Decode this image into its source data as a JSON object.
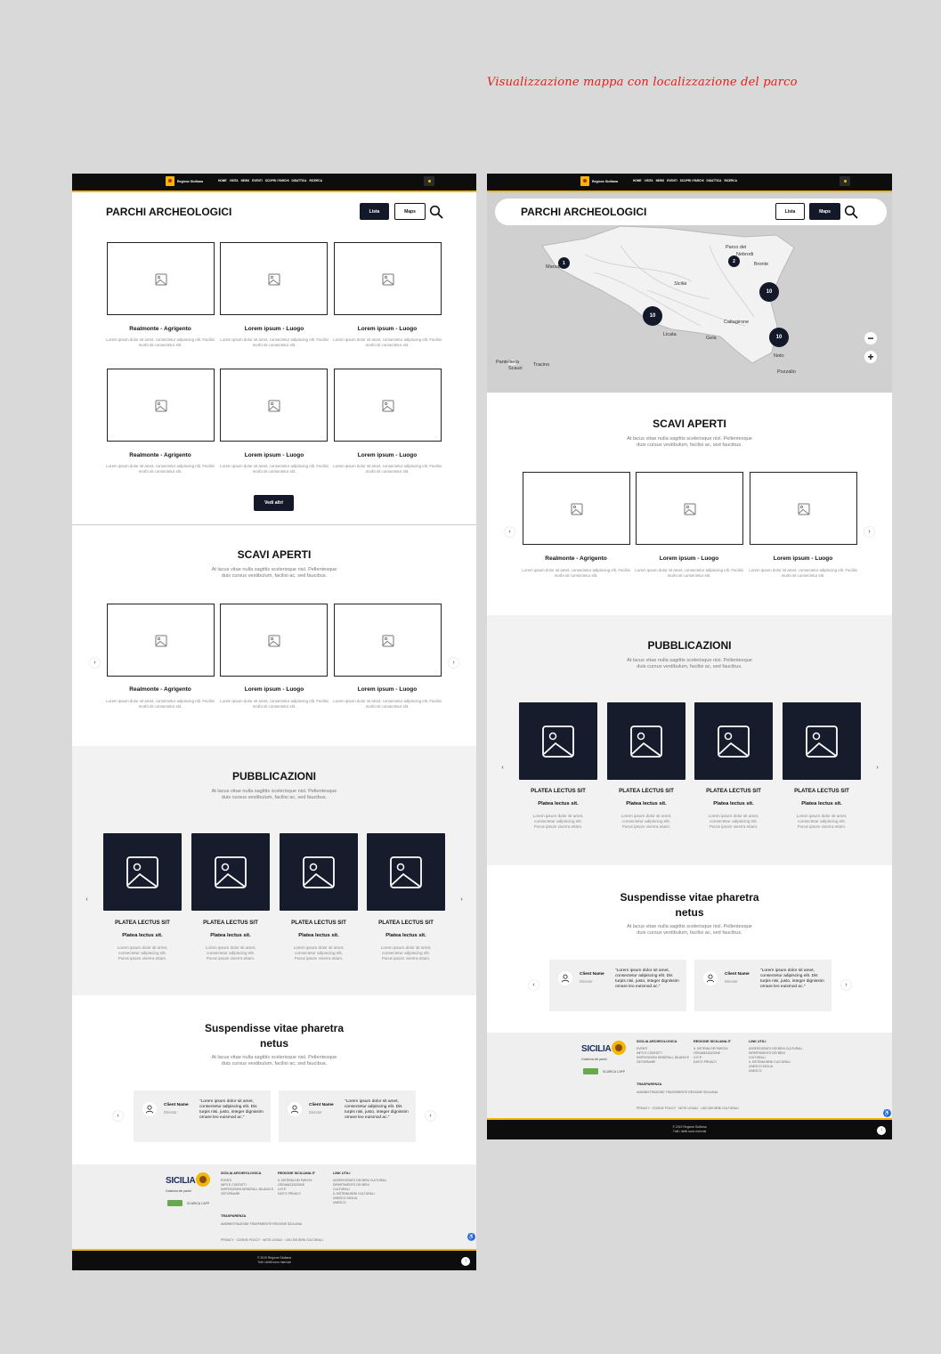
{
  "annotation": "Visualizzazione mappa con localizzazione del parco",
  "nav": {
    "brand": "Regione Siciliana",
    "items": [
      "HOME",
      "VISITA",
      "NEWS",
      "EVENTI",
      "SCOPRI I PARCHI",
      "DIDATTICA",
      "RICERCA"
    ]
  },
  "header": {
    "title": "PARCHI ARCHEOLOGICI",
    "lista": "Lista",
    "maps": "Maps"
  },
  "parks": [
    {
      "title": "Realmonte - Agrigento",
      "desc": "Lorem ipsum dolor sit amet, consectetur adipiscing elit. Facilisi morbi sit consectetur elit."
    },
    {
      "title": "Lorem ipsum - Luogo",
      "desc": "Lorem ipsum dolor sit amet, consectetur adipiscing elit. Facilisi morbi sit consectetur elit."
    },
    {
      "title": "Lorem ipsum - Luogo",
      "desc": "Lorem ipsum dolor sit amet, consectetur adipiscing elit. Facilisi morbi sit consectetur elit."
    },
    {
      "title": "Realmonte - Agrigento",
      "desc": "Lorem ipsum dolor sit amet, consectetur adipiscing elit. Facilisi morbi sit consectetur elit."
    },
    {
      "title": "Lorem ipsum - Luogo",
      "desc": "Lorem ipsum dolor sit amet, consectetur adipiscing elit. Facilisi morbi sit consectetur elit."
    },
    {
      "title": "Lorem ipsum - Luogo",
      "desc": "Lorem ipsum dolor sit amet, consectetur adipiscing elit. Facilisi morbi sit consectetur elit."
    }
  ],
  "vedi_altri": "Vedi altri",
  "scavi": {
    "title": "SCAVI APERTI",
    "subtitle_l1": "At lacus vitae nulla sagittis scelerisque nisl. Pellentesque",
    "subtitle_l2": "duis cursus vestibulum, facilisi ac, sed faucibus."
  },
  "pubblicazioni": {
    "title": "PUBBLICAZIONI",
    "items": [
      {
        "t1": "PLATEA LECTUS SIT",
        "t2": "Platea lectus sit.",
        "d1": "Lorem ipsum dolor sit amet,",
        "d2": "consectetur adipiscing elit.",
        "d3": "Purus ipsum viverra etiam."
      },
      {
        "t1": "PLATEA LECTUS SIT",
        "t2": "Platea lectus sit.",
        "d1": "Lorem ipsum dolor sit amet,",
        "d2": "consectetur adipiscing elit.",
        "d3": "Purus ipsum viverra etiam."
      },
      {
        "t1": "PLATEA LECTUS SIT",
        "t2": "Platea lectus sit.",
        "d1": "Lorem ipsum dolor sit amet,",
        "d2": "consectetur adipiscing elit.",
        "d3": "Purus ipsum viverra etiam."
      },
      {
        "t1": "PLATEA LECTUS SIT",
        "t2": "Platea lectus sit.",
        "d1": "Lorem ipsum dolor sit amet,",
        "d2": "consectetur adipiscing elit.",
        "d3": "Purus ipsum viverra etiam."
      }
    ]
  },
  "testimonials": {
    "title_l1": "Suspendisse vitae pharetra",
    "title_l2": "netus",
    "items": [
      {
        "name": "Client Name",
        "role": "Director",
        "quote": "\"Lorem ipsum dolor sit amet, consectetur adipiscing elit. Dis turpis nisi, justo, integer dignissim ornare leo euismod ac.\""
      },
      {
        "name": "Client Name",
        "role": "Director",
        "quote": "\"Lorem ipsum dolor sit amet, consectetur adipiscing elit. Dis turpis nisi, justo, integer dignissim ornare leo euismod ac.\""
      }
    ]
  },
  "footer": {
    "logo_text": "SICILIA",
    "logo_sub": "il sistema dei parchi",
    "app_label": "SCARICA L'APP",
    "col1": {
      "heading": "SICILIA ARCHEOLOGICA",
      "items": [
        "EVENTI",
        "INFO E CONTATTI",
        "DISPOSIZIONI GENERALI, BILANCI E",
        "GETORNARE"
      ]
    },
    "col2": {
      "heading": "REGIONE SICILIANA.IT",
      "items": [
        "IL SISTEMA DEI PARCHI",
        "ORGANIZZAZIONE",
        "U.R.P.",
        "DATI E PRIVACY"
      ]
    },
    "col3": {
      "heading": "LINK UTILI",
      "items": [
        "ASSESSORATO DEI BENI CULTURALI",
        "DIPARTIMENTO DEI BENI",
        "CULTURALI",
        "IL SISTEMA BENI CULTURALI",
        "UNESCO SICILIA",
        "UNESCO"
      ]
    },
    "trasparenza": "TRASPARENZA",
    "trasparenza_item": "AMMINISTRAZIONE TRASPARENTE REGIONE SICILIANA",
    "legal": "PRIVACY · COOKIE POLICY · NOTE LEGALI · USO DEI BENI CULTURALI",
    "copyright_l1": "© 2019 Regione Siciliana",
    "copyright_l2": "Tutti i diritti sono riservati"
  },
  "map": {
    "pins": [
      "1",
      "2",
      "10",
      "10",
      "10"
    ],
    "labels": [
      "Marsala",
      "Parco dei",
      "Nebrodi",
      "Bronte",
      "Sicilia",
      "Caltagirone",
      "Gela",
      "Licata",
      "Noto",
      "Pozzallo",
      "Pantelleria",
      "Scauri",
      "Tracino"
    ]
  }
}
